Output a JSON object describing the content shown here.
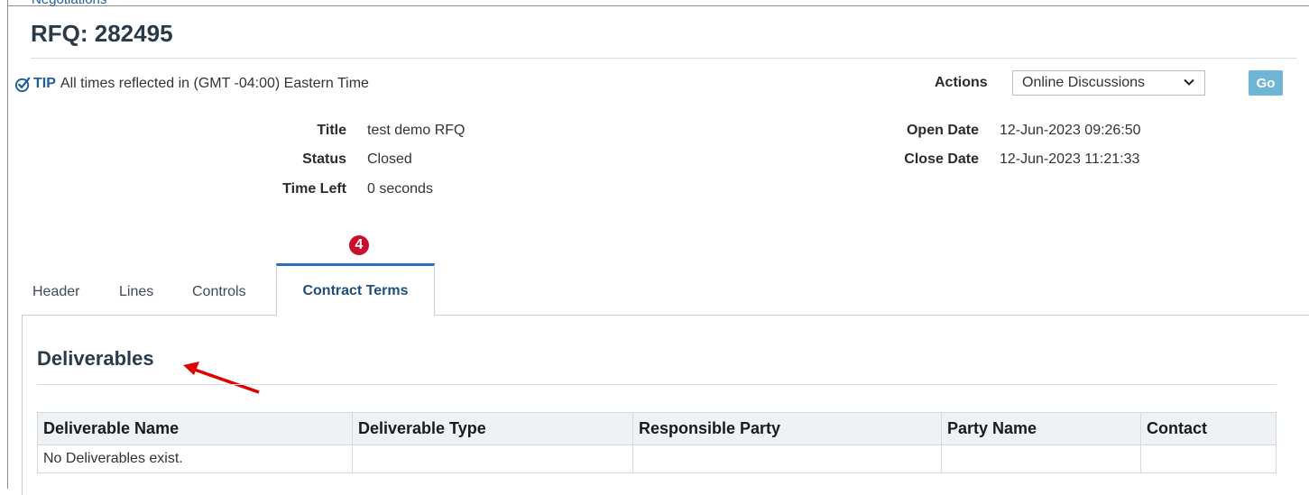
{
  "breadcrumb": "Negotiations",
  "page_title": "RFQ: 282495",
  "tip": {
    "label": "TIP",
    "text": "All times reflected in (GMT -04:00) Eastern Time"
  },
  "actions": {
    "label": "Actions",
    "selected": "Online Discussions",
    "go_label": "Go"
  },
  "fields": {
    "title": {
      "label": "Title",
      "value": "test demo RFQ"
    },
    "status": {
      "label": "Status",
      "value": "Closed"
    },
    "time_left": {
      "label": "Time Left",
      "value": "0 seconds"
    },
    "open_date": {
      "label": "Open Date",
      "value": "12-Jun-2023 09:26:50"
    },
    "close_date": {
      "label": "Close Date",
      "value": "12-Jun-2023 11:21:33"
    }
  },
  "step_badge": "4",
  "tabs": [
    {
      "label": "Header"
    },
    {
      "label": "Lines"
    },
    {
      "label": "Controls"
    },
    {
      "label": "Contract Terms",
      "active": true
    }
  ],
  "section": {
    "title": "Deliverables"
  },
  "table": {
    "columns": [
      "Deliverable Name",
      "Deliverable Type",
      "Responsible Party",
      "Party Name",
      "Contact"
    ],
    "empty_message": "No Deliverables exist."
  },
  "colors": {
    "accent": "#1f5e9e",
    "go_button": "#6fb6d6",
    "badge": "#c8102e",
    "arrow": "#e00000",
    "tab_active": "#2f6fb5"
  },
  "icons": {
    "tip": "checkmark-circle-icon",
    "select": "chevron-down-icon",
    "annotation": "red-arrow-icon"
  }
}
